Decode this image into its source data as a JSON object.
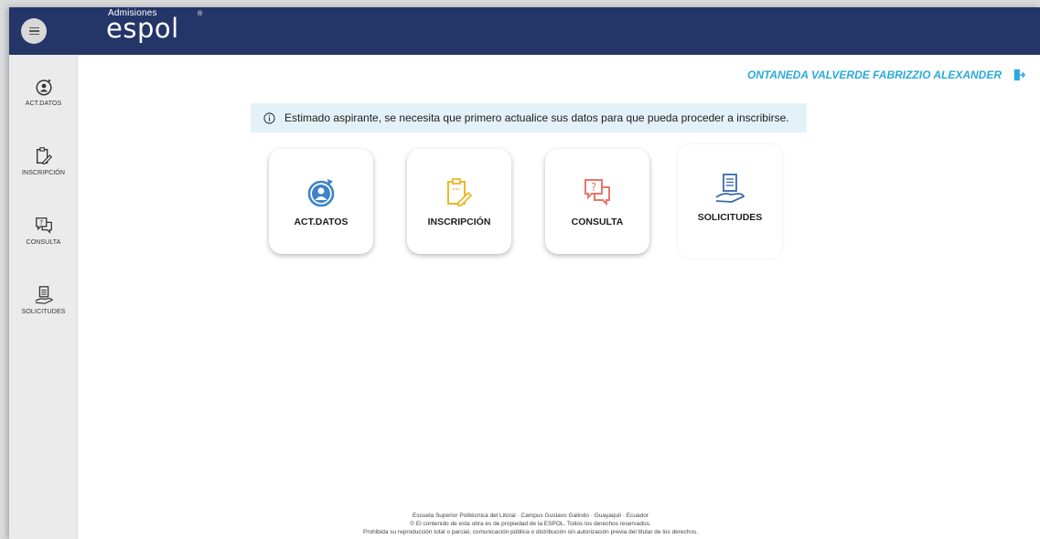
{
  "header": {
    "logo_small": "Admisiones",
    "logo_main": "espol",
    "logo_reg": "®"
  },
  "sidebar": {
    "items": [
      {
        "label": "ACT.DATOS",
        "icon": "user-refresh-icon"
      },
      {
        "label": "INSCRIPCIÓN",
        "icon": "clipboard-edit-icon"
      },
      {
        "label": "CONSULTA",
        "icon": "question-chat-icon"
      },
      {
        "label": "SOLICITUDES",
        "icon": "hand-document-icon"
      }
    ]
  },
  "user": {
    "name": "ONTANEDA VALVERDE FABRIZZIO ALEXANDER",
    "logout_icon": "logout-icon"
  },
  "alert": {
    "text": "Estimado aspirante, se necesita que primero actualice sus datos para que pueda proceder a inscribirse.",
    "icon": "info-icon"
  },
  "cards": [
    {
      "label": "ACT.DATOS",
      "icon": "user-refresh-icon",
      "color": "#3f83c8"
    },
    {
      "label": "INSCRIPCIÓN",
      "icon": "clipboard-edit-icon",
      "color": "#e9b92a"
    },
    {
      "label": "CONSULTA",
      "icon": "question-chat-icon",
      "color": "#e9766b"
    },
    {
      "label": "SOLICITUDES",
      "icon": "hand-document-icon",
      "color": "#3a6aa6"
    }
  ],
  "footer": {
    "line1": "Escuela Superior Politécnica del Litoral · Campus Gustavo Galindo · Guayaquil · Ecuador",
    "line2": "© El contenido de esta obra es de propiedad de la ESPOL. Todos los derechos reservados.",
    "line3": "Prohibida su reproducción total o parcial, comunicación pública o distribución sin autorización previa del titular de los derechos."
  },
  "colors": {
    "header_bg": "#243568",
    "accent": "#2aa9dc",
    "alert_bg": "#e3f2f8"
  }
}
